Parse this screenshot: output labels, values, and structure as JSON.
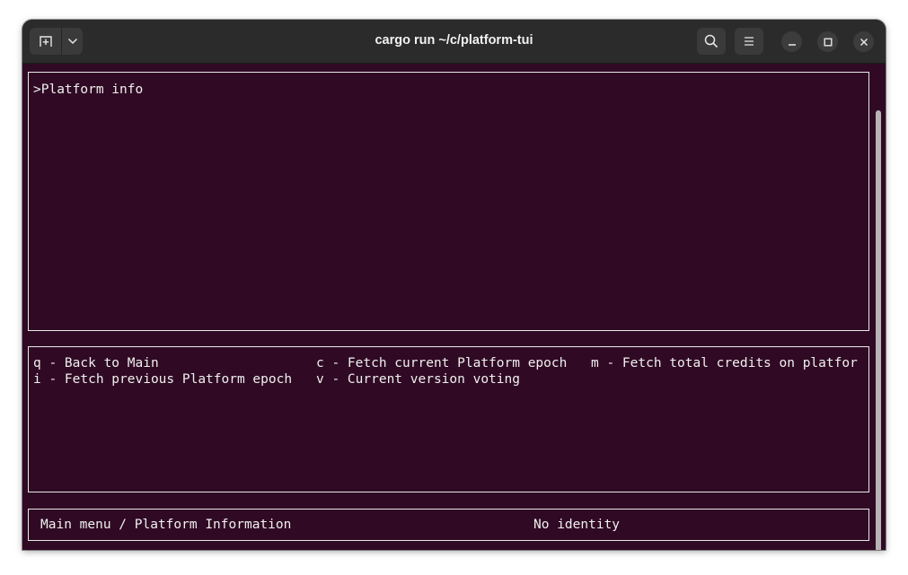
{
  "window": {
    "title": "cargo run ~/c/platform-tui"
  },
  "titlebar_icons": {
    "new_tab": "new-tab-icon",
    "dropdown": "chevron-down-icon",
    "search": "search-icon",
    "menu": "hamburger-menu-icon",
    "minimize": "minimize-icon",
    "maximize": "maximize-icon",
    "close": "close-icon"
  },
  "output_panel": {
    "prompt": ">Platform info"
  },
  "keys_panel": {
    "commands": [
      "q - Back to Main",
      "c - Fetch current Platform epoch",
      "m - Fetch total credits on platfor",
      "i - Fetch previous Platform epoch",
      "v - Current version voting"
    ]
  },
  "status_bar": {
    "breadcrumb": "Main menu / Platform Information",
    "identity": "No identity"
  },
  "colors": {
    "terminal_bg": "#300a24",
    "titlebar_bg": "#2b2b2b",
    "text": "#f0f0f0",
    "border": "#e8e8e8"
  }
}
